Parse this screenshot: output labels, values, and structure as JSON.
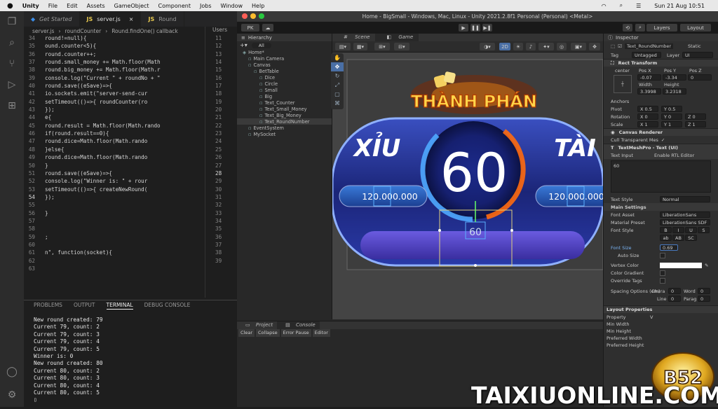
{
  "macbar": {
    "app": "Unity",
    "menus": [
      "File",
      "Edit",
      "Assets",
      "GameObject",
      "Component",
      "Jobs",
      "Window",
      "Help"
    ],
    "clock": "Sun 21 Aug  10:51"
  },
  "vscode": {
    "tabs": [
      "Get Started",
      "server.js",
      "Round"
    ],
    "breadcrumb": [
      "server.js",
      "roundCounter",
      "Round.findOne() callback"
    ],
    "code": [
      {
        "n": "34",
        "t": "  round!=null){"
      },
      {
        "n": "35",
        "t": "ound.counter<5){"
      },
      {
        "n": "36",
        "t": "round.counter++;"
      },
      {
        "n": "37",
        "t": "round.small_money += Math.floor(Math"
      },
      {
        "n": "38",
        "t": "round.big_money += Math.floor(Math.r"
      },
      {
        "n": "39",
        "t": "console.log(\"Current \" + roundNo + \""
      },
      {
        "n": "40",
        "t": "round.save((eSave)=>{"
      },
      {
        "n": "41",
        "t": "    io.sockets.emit(\"server-send-cur"
      },
      {
        "n": "42",
        "t": "    setTimeout(()=>{ roundCounter(ro"
      },
      {
        "n": "43",
        "t": "});"
      },
      {
        "n": "44",
        "t": "e{"
      },
      {
        "n": "45",
        "t": "round.result = Math.floor(Math.rando"
      },
      {
        "n": "46",
        "t": "if(round.result==0){"
      },
      {
        "n": "47",
        "t": "    round.dice=Math.floor(Math.rando"
      },
      {
        "n": "48",
        "t": "}else{"
      },
      {
        "n": "49",
        "t": "    round.dice=Math.floor(Math.rando"
      },
      {
        "n": "50",
        "t": "}"
      },
      {
        "n": "51",
        "t": "round.save((eSave)=>{"
      },
      {
        "n": "52",
        "t": "    console.log(\"Winner is: \" + rour"
      },
      {
        "n": "53",
        "t": "    setTimeout(()=>{ createNewRound("
      },
      {
        "n": "54",
        "t": "});"
      },
      {
        "n": "55",
        "t": ""
      },
      {
        "n": "56",
        "t": "}"
      },
      {
        "n": "57",
        "t": ""
      },
      {
        "n": "58",
        "t": ""
      },
      {
        "n": "59",
        "t": ";"
      },
      {
        "n": "60",
        "t": ""
      },
      {
        "n": "61",
        "t": "n\", function(socket){"
      },
      {
        "n": "62",
        "t": ""
      },
      {
        "n": "63",
        "t": ""
      }
    ],
    "code2_lines": [
      "11",
      "12",
      "13",
      "14",
      "15",
      "16",
      "17",
      "18",
      "19",
      "20",
      "21",
      "22",
      "23",
      "24",
      "25",
      "26",
      "27",
      "28",
      "29",
      "30",
      "31",
      "32",
      "33",
      "34",
      "35",
      "36",
      "37",
      "38",
      "39"
    ],
    "code2_header": "Users",
    "panel_tabs": [
      "PROBLEMS",
      "OUTPUT",
      "TERMINAL",
      "DEBUG CONSOLE"
    ],
    "terminal": [
      "New round created: 79",
      "Current 79, count: 2",
      "Current 79, count: 3",
      "Current 79, count: 4",
      "Current 79, count: 5",
      "Winner is: 0",
      "New round created: 80",
      "Current 80, count: 2",
      "Current 80, count: 3",
      "Current 80, count: 4",
      "Current 80, count: 5",
      "▯"
    ]
  },
  "unity": {
    "title": "Home - BigSmall - Windows, Mac, Linux - Unity 2021.2.8f1 Personal (Personal) <Metal>",
    "account": "PK",
    "layers": "Layers",
    "layout": "Layout",
    "hierarchy_title": "Hierarchy",
    "hierarchy_search": "All",
    "hierarchy": [
      {
        "d": 0,
        "t": "Home*"
      },
      {
        "d": 1,
        "t": "Main Camera"
      },
      {
        "d": 1,
        "t": "Canvas"
      },
      {
        "d": 2,
        "t": "BetTable"
      },
      {
        "d": 3,
        "t": "Dice"
      },
      {
        "d": 3,
        "t": "Circle"
      },
      {
        "d": 3,
        "t": "Small"
      },
      {
        "d": 3,
        "t": "Big"
      },
      {
        "d": 3,
        "t": "Text_Counter"
      },
      {
        "d": 3,
        "t": "Text_Small_Money"
      },
      {
        "d": 3,
        "t": "Text_Big_Money"
      },
      {
        "d": 3,
        "t": "Text_RoundNumber",
        "sel": true
      },
      {
        "d": 1,
        "t": "EventSystem"
      },
      {
        "d": 1,
        "t": "MySocket"
      }
    ],
    "scene_tabs": [
      "Scene",
      "Game"
    ],
    "scene_2d": "2D",
    "game": {
      "banner": "THÀNH PHÁN",
      "left": "XỈU",
      "right": "TÀI",
      "counter": "60",
      "small_money": "120.000.000",
      "big_money": "120.000.000",
      "round_text": "60"
    },
    "console_tabs": [
      "Project",
      "Console"
    ],
    "console_tools": [
      "Clear",
      "Collapse",
      "Error Pause",
      "Editor"
    ],
    "inspector": {
      "title": "Inspector",
      "object": "Text_RoundNumber",
      "static": "Static",
      "tag_label": "Tag",
      "tag": "Untagged",
      "layer_label": "Layer",
      "layer": "UI",
      "rect": "Rect Transform",
      "anchor": "center",
      "pos_labels": [
        "Pos X",
        "Pos Y",
        "Pos Z"
      ],
      "pos": [
        "-0.07",
        "-3.34",
        "0"
      ],
      "size_labels": [
        "Width",
        "Height"
      ],
      "size": [
        "3.3998",
        "3.2318"
      ],
      "anchors": "Anchors",
      "pivot_label": "Pivot",
      "pivot": [
        "X 0.5",
        "Y 0.5"
      ],
      "rotation_label": "Rotation",
      "rotation": [
        "X 0",
        "Y 0",
        "Z 0"
      ],
      "scale_label": "Scale",
      "scale": [
        "X 1",
        "Y 1",
        "Z 1"
      ],
      "canvas_renderer": "Canvas Renderer",
      "cull": "Cull Transparent Mes",
      "tmp": "TextMeshPro - Text (UI)",
      "text_input": "Text Input",
      "rtl": "Enable RTL Editor",
      "text_value": "60",
      "text_style_label": "Text Style",
      "text_style": "Normal",
      "main_settings": "Main Settings",
      "font_asset_label": "Font Asset",
      "font_asset": "LiberationSans",
      "material_label": "Material Preset",
      "material": "LiberationSans SDF",
      "font_style_label": "Font Style",
      "styles": [
        "B",
        "I",
        "U",
        "S",
        "ab",
        "AB",
        "SC"
      ],
      "font_size_label": "Font Size",
      "font_size": "0.69",
      "auto_size": "Auto Size",
      "vertex_color": "Vertex Color",
      "color_gradient": "Color Gradient",
      "override_tags": "Override Tags",
      "spacing_label": "Spacing Options (em)",
      "spacing": [
        "Chara",
        "0",
        "Word",
        "0"
      ],
      "spacing2": [
        "Line",
        "0",
        "Parag",
        "0"
      ],
      "layout_props": "Layout Properties",
      "property": "Property",
      "v": "V",
      "layout_rows": [
        "Min Width",
        "Min Height",
        "Preferred Width",
        "Preferred Height"
      ]
    }
  },
  "watermark": "TAIXIUONLINE.COM",
  "badge_text": "B52"
}
